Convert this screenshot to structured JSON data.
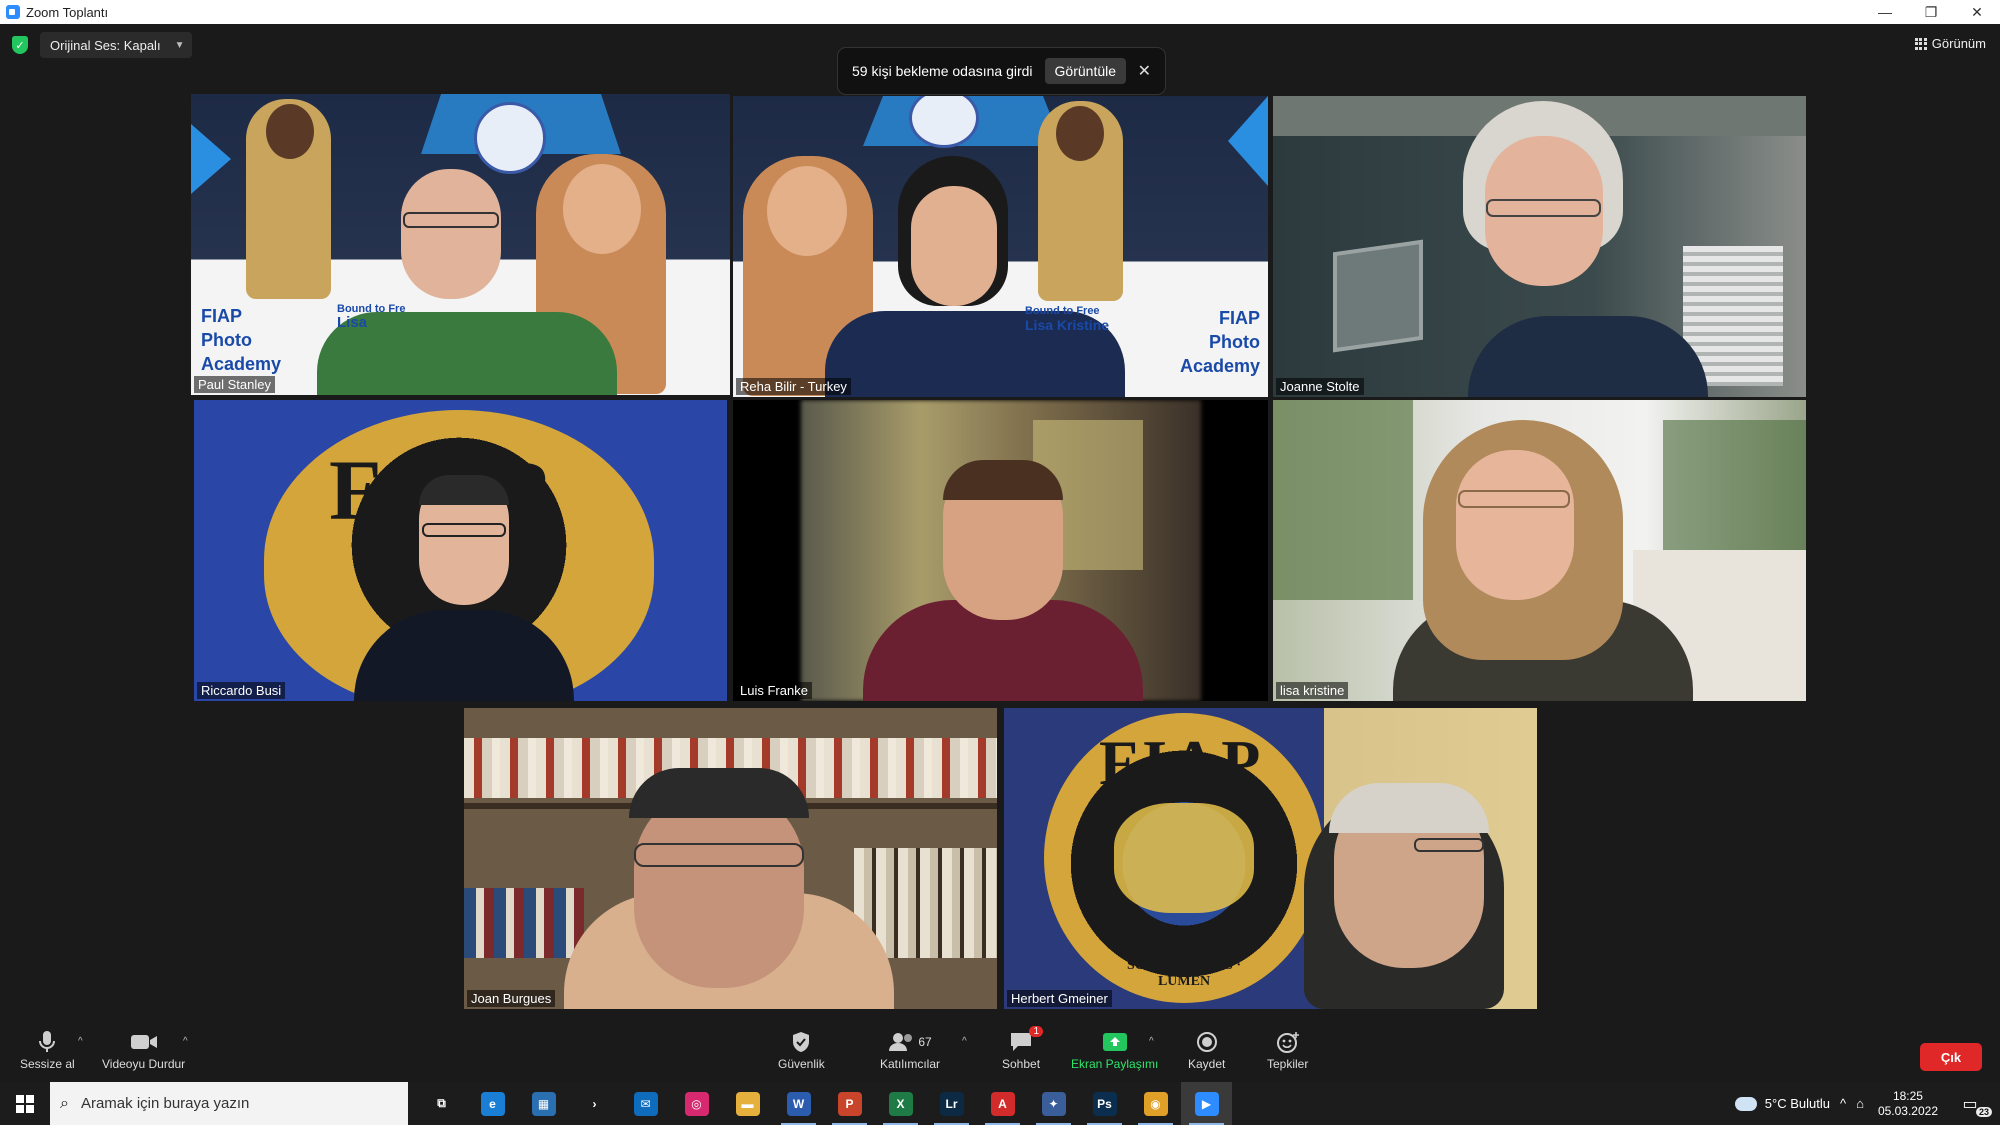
{
  "window": {
    "title": "Zoom Toplantı",
    "controls": [
      "—",
      "❐",
      "✕"
    ]
  },
  "top": {
    "audio_label": "Orijinal Ses: Kapalı",
    "view_label": "Görünüm",
    "waiting": {
      "text": "59 kişi bekleme odasına girdi",
      "view_label": "Görüntüle",
      "close": "✕"
    }
  },
  "tiles": [
    {
      "name": "Paul Stanley",
      "active": true
    },
    {
      "name": "Reha Bilir - Turkey"
    },
    {
      "name": "Joanne Stolte"
    },
    {
      "name": "Riccardo Busi"
    },
    {
      "name": "Luis Franke"
    },
    {
      "name": "lisa kristine"
    },
    {
      "name": "Joan Burgues"
    },
    {
      "name": "Herbert Gmeiner"
    }
  ],
  "tile_text": {
    "poster_left": [
      "FIAP",
      "Photo",
      "Academy"
    ],
    "poster_left_small": [
      "Bound to Fre",
      "Lisa"
    ],
    "poster_right": [
      "FIAP",
      "Photo",
      "Academy"
    ],
    "poster_right_small": [
      "Bound to Free",
      "Lisa Kristine"
    ],
    "fiap_logo": "FIAP",
    "fiap_motto": "SCIENTIA · ARS · LUMEN",
    "fiap_partial_left": "SC",
    "fiap_partial_right": "EN"
  },
  "toolbar": {
    "mute": "Sessize al",
    "video": "Videoyu Durdur",
    "security": "Güvenlik",
    "participants": "Katılımcılar",
    "participants_count": "67",
    "chat": "Sohbet",
    "chat_badge": "1",
    "share": "Ekran Paylaşımı",
    "record": "Kaydet",
    "reactions": "Tepkiler",
    "leave": "Çık"
  },
  "taskbar": {
    "search_placeholder": "Aramak için buraya yazın",
    "apps": [
      {
        "name": "task-view",
        "glyph": "⧉",
        "color": "#1c1c1c"
      },
      {
        "name": "edge",
        "glyph": "e",
        "color": "#1a7fd4"
      },
      {
        "name": "store",
        "glyph": "▦",
        "color": "#2a6fb0"
      },
      {
        "name": "arrow",
        "glyph": "›",
        "color": "#1c1c1c"
      },
      {
        "name": "mail",
        "glyph": "✉",
        "color": "#0f6cbd"
      },
      {
        "name": "instagram",
        "glyph": "◎",
        "color": "#d6296f"
      },
      {
        "name": "explorer",
        "glyph": "▬",
        "color": "#e6b03c"
      },
      {
        "name": "word",
        "glyph": "W",
        "color": "#2b5cad"
      },
      {
        "name": "powerpoint",
        "glyph": "P",
        "color": "#c8452c"
      },
      {
        "name": "excel",
        "glyph": "X",
        "color": "#1f7b45"
      },
      {
        "name": "lightroom",
        "glyph": "Lr",
        "color": "#0d2a44"
      },
      {
        "name": "acrobat",
        "glyph": "A",
        "color": "#d12b2b"
      },
      {
        "name": "app-bird",
        "glyph": "✦",
        "color": "#3a5e9a"
      },
      {
        "name": "photoshop",
        "glyph": "Ps",
        "color": "#0b2e4f"
      },
      {
        "name": "chrome",
        "glyph": "◉",
        "color": "#e0a028"
      },
      {
        "name": "zoom",
        "glyph": "▶",
        "color": "#2D8CFF"
      }
    ],
    "weather": "5°C  Bulutlu",
    "time": "18:25",
    "date": "05.03.2022",
    "notif_count": "23"
  }
}
